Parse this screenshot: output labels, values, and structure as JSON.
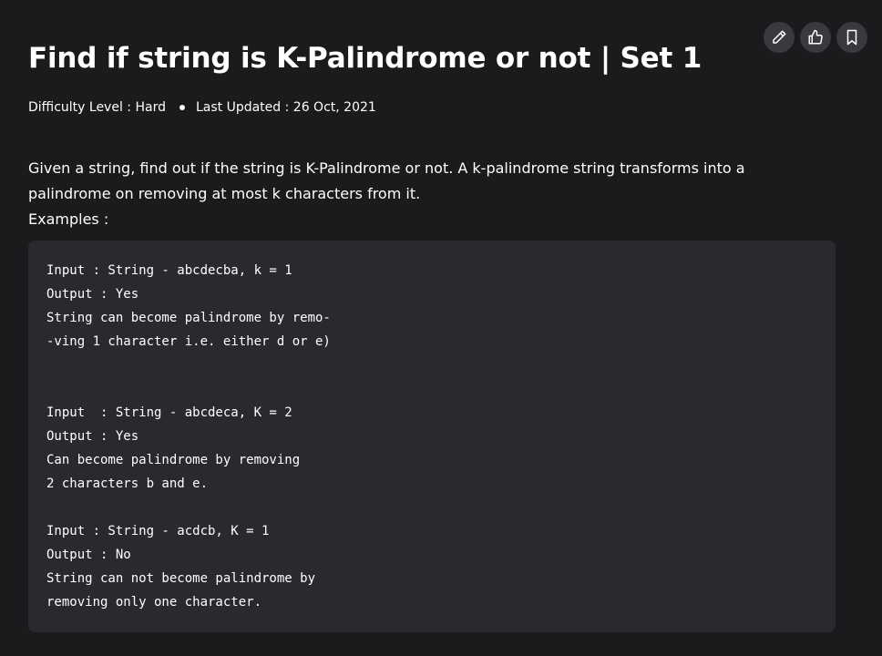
{
  "article": {
    "title": "Find if string is K-Palindrome or not | Set 1",
    "difficulty": "Difficulty Level : Hard",
    "last_updated": "Last Updated : 26 Oct, 2021",
    "intro_line": "Given a string, find out if the string is K-Palindrome or not. A k-palindrome string transforms into a palindrome on removing at most k characters from it.",
    "examples_label": "Examples :",
    "code": "Input : String - abcdecba, k = 1\nOutput : Yes\nString can become palindrome by remo-\n-ving 1 character i.e. either d or e)\n\n\nInput  : String - abcdeca, K = 2\nOutput : Yes\nCan become palindrome by removing\n2 characters b and e.\n\nInput : String - acdcb, K = 1\nOutput : No\nString can not become palindrome by\nremoving only one character."
  },
  "actions": {
    "edit_icon": "pencil-icon",
    "like_icon": "thumbs-up-icon",
    "bookmark_icon": "bookmark-icon"
  },
  "colors": {
    "background": "#1b1b1e",
    "code_background": "#2a2a2e",
    "action_button": "#3a3a3e"
  }
}
